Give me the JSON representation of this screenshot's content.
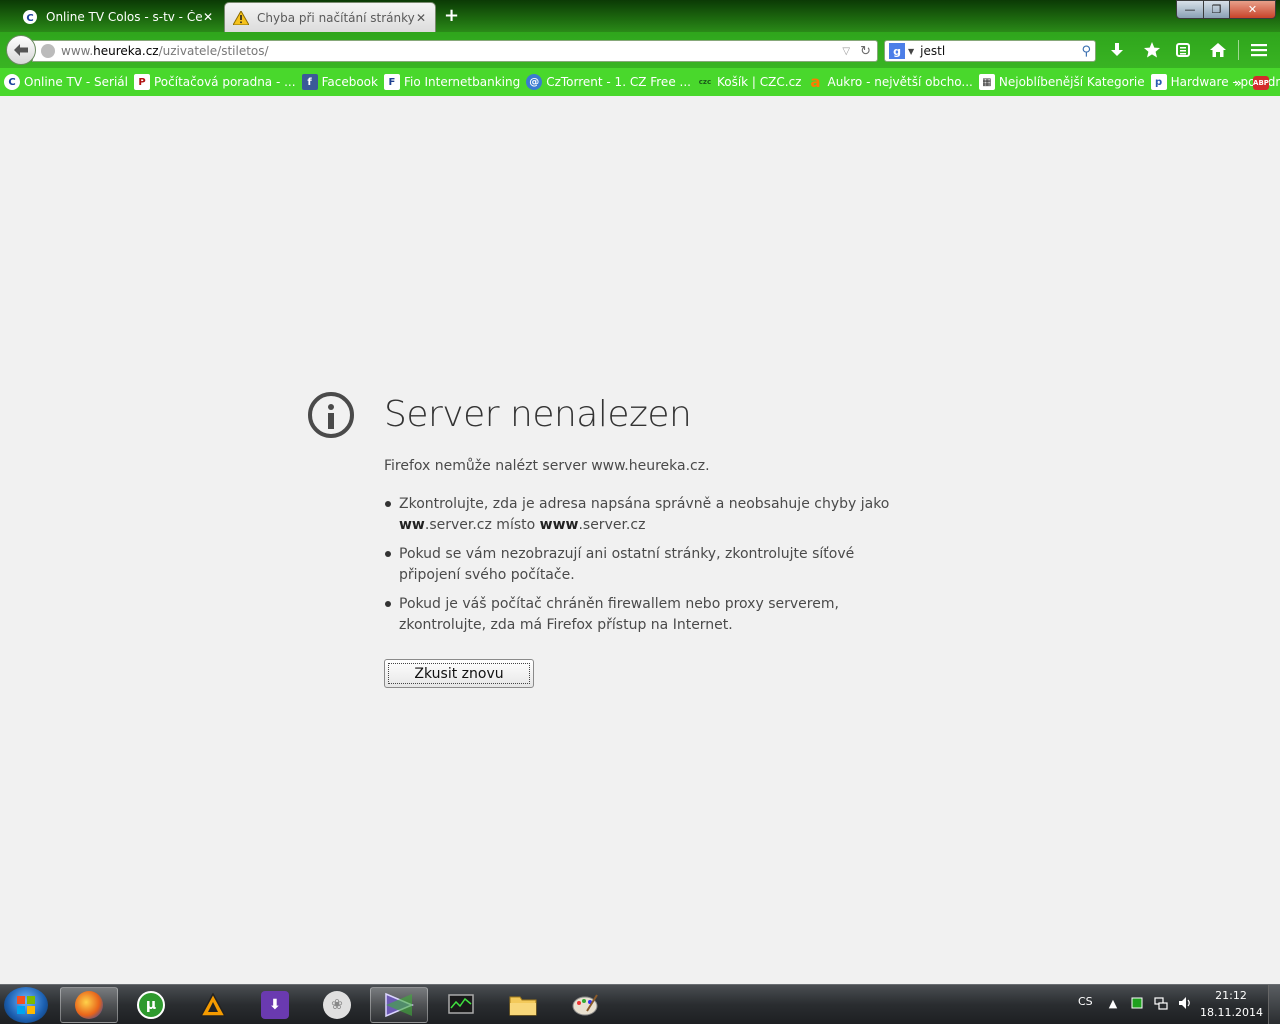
{
  "tabs": [
    {
      "title": "Online TV Colos - s-tv - Če...",
      "favicon": "colos-c-icon",
      "active": false
    },
    {
      "title": "Chyba při načítání stránky",
      "favicon": "warning-icon",
      "active": true
    }
  ],
  "window": {
    "minimize": "—",
    "maximize": "❐",
    "close": "✕"
  },
  "navbar": {
    "url_prefix": "www.",
    "url_host": "heureka.cz",
    "url_path": "/uzivatele/stiletos/",
    "search_value": "jestl",
    "search_engine_letter": "g"
  },
  "bookmarks": [
    {
      "label": "Online TV - Seriál",
      "icon": "colos-c-icon",
      "icon_text": "C",
      "icon_color": "#1a3f9b"
    },
    {
      "label": "Počítačová poradna - ...",
      "icon": "pcnet-icon",
      "icon_text": "P",
      "icon_color": "#b01010"
    },
    {
      "label": "Facebook",
      "icon": "facebook-icon",
      "icon_text": "f",
      "icon_color": "#3b5998"
    },
    {
      "label": "Fio Internetbanking",
      "icon": "fio-icon",
      "icon_text": "F",
      "icon_color": "#1d3f8f"
    },
    {
      "label": "CzTorrent - 1. CZ Free ...",
      "icon": "cztorrent-icon",
      "icon_text": "@",
      "icon_color": "#3a7bd0"
    },
    {
      "label": "Košík | CZC.cz",
      "icon": "czc-icon",
      "icon_text": "czc",
      "icon_color": "#2a8a2a"
    },
    {
      "label": "Aukro - největší obcho...",
      "icon": "aukro-icon",
      "icon_text": "a",
      "icon_color": "#ff7a00"
    },
    {
      "label": "Nejoblíbenější Kategorie",
      "icon": "grid-icon",
      "icon_text": "▦",
      "icon_color": "#ffffff"
    },
    {
      "label": "Hardware - poradna",
      "icon": "pcnet-small-icon",
      "icon_text": "p",
      "icon_color": "#2a5ab0"
    }
  ],
  "bookmarks_overflow": "»",
  "abp_label": "ABP",
  "error": {
    "title": "Server nenalezen",
    "description": "Firefox nemůže nalézt server www.heureka.cz.",
    "suggestion_1a": "Zkontrolujte, zda je adresa napsána správně a neobsahuje chyby jako",
    "suggestion_1b_bold1": "ww",
    "suggestion_1b_mid": ".server.cz místo ",
    "suggestion_1b_bold2": "www",
    "suggestion_1b_end": ".server.cz",
    "suggestion_2": "Pokud se vám nezobrazují ani ostatní stránky, zkontrolujte síťové připojení svého počítače.",
    "suggestion_3": "Pokud je váš počítač chráněn firewallem nebo proxy serverem, zkontrolujte, zda má Firefox přístup na Internet.",
    "retry_label": "Zkusit znovu"
  },
  "taskbar": {
    "apps": [
      {
        "name": "firefox",
        "active": true
      },
      {
        "name": "utorrent",
        "active": false
      },
      {
        "name": "aimp",
        "active": false
      },
      {
        "name": "downloader",
        "active": false
      },
      {
        "name": "footprint",
        "active": false
      },
      {
        "name": "media-player",
        "active": true
      },
      {
        "name": "task-manager",
        "active": false
      },
      {
        "name": "explorer",
        "active": false
      },
      {
        "name": "paint",
        "active": false
      }
    ],
    "language": "CS",
    "time": "21:12",
    "date": "18.11.2014"
  }
}
